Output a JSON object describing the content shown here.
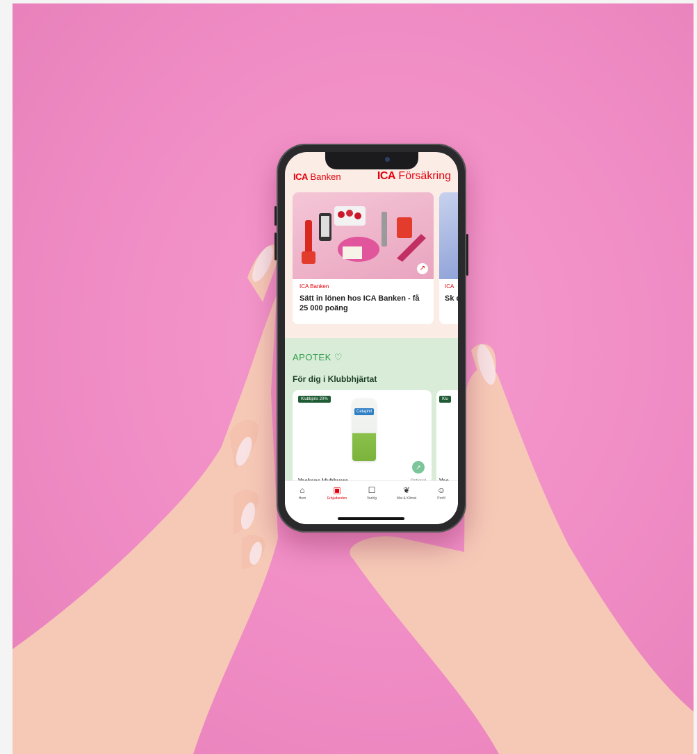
{
  "app": {
    "brand_left": "ICA Banken",
    "brand_right": "ICA Försäkring",
    "brand_left_logo": "ICA",
    "brand_left_word": "Banken",
    "brand_right_logo": "ICA",
    "brand_right_word": "Försäkring"
  },
  "promos": [
    {
      "tag": "ICA Banken",
      "title": "Sätt in lönen hos ICA Banken - få 25 000 poäng",
      "icon": "external-link-icon"
    },
    {
      "tag": "ICA",
      "title": "Sk du"
    }
  ],
  "apotek": {
    "brand": "APOTEK",
    "section_title": "För dig i Klubbhjärtat",
    "products": [
      {
        "badge": "Klubbpris 20%",
        "product_label": "Cetaphil",
        "title": "Veckans klubbvara",
        "note": "Optional"
      },
      {
        "badge": "Klu",
        "title": "Vec"
      }
    ]
  },
  "tabs": [
    {
      "label": "Hem",
      "icon": "home-icon",
      "active": false
    },
    {
      "label": "Erbjudanden",
      "icon": "offers-icon",
      "active": true
    },
    {
      "label": "Varlög",
      "icon": "shopping-bag-icon",
      "active": false
    },
    {
      "label": "Mat & Klimat",
      "icon": "leaf-icon",
      "active": false
    },
    {
      "label": "Profil",
      "icon": "profile-icon",
      "active": false
    }
  ],
  "colors": {
    "background": "#f08cc5",
    "ica_red": "#e3000b",
    "apotek_green": "#2e9b4b",
    "badge_green": "#1f5b34"
  }
}
